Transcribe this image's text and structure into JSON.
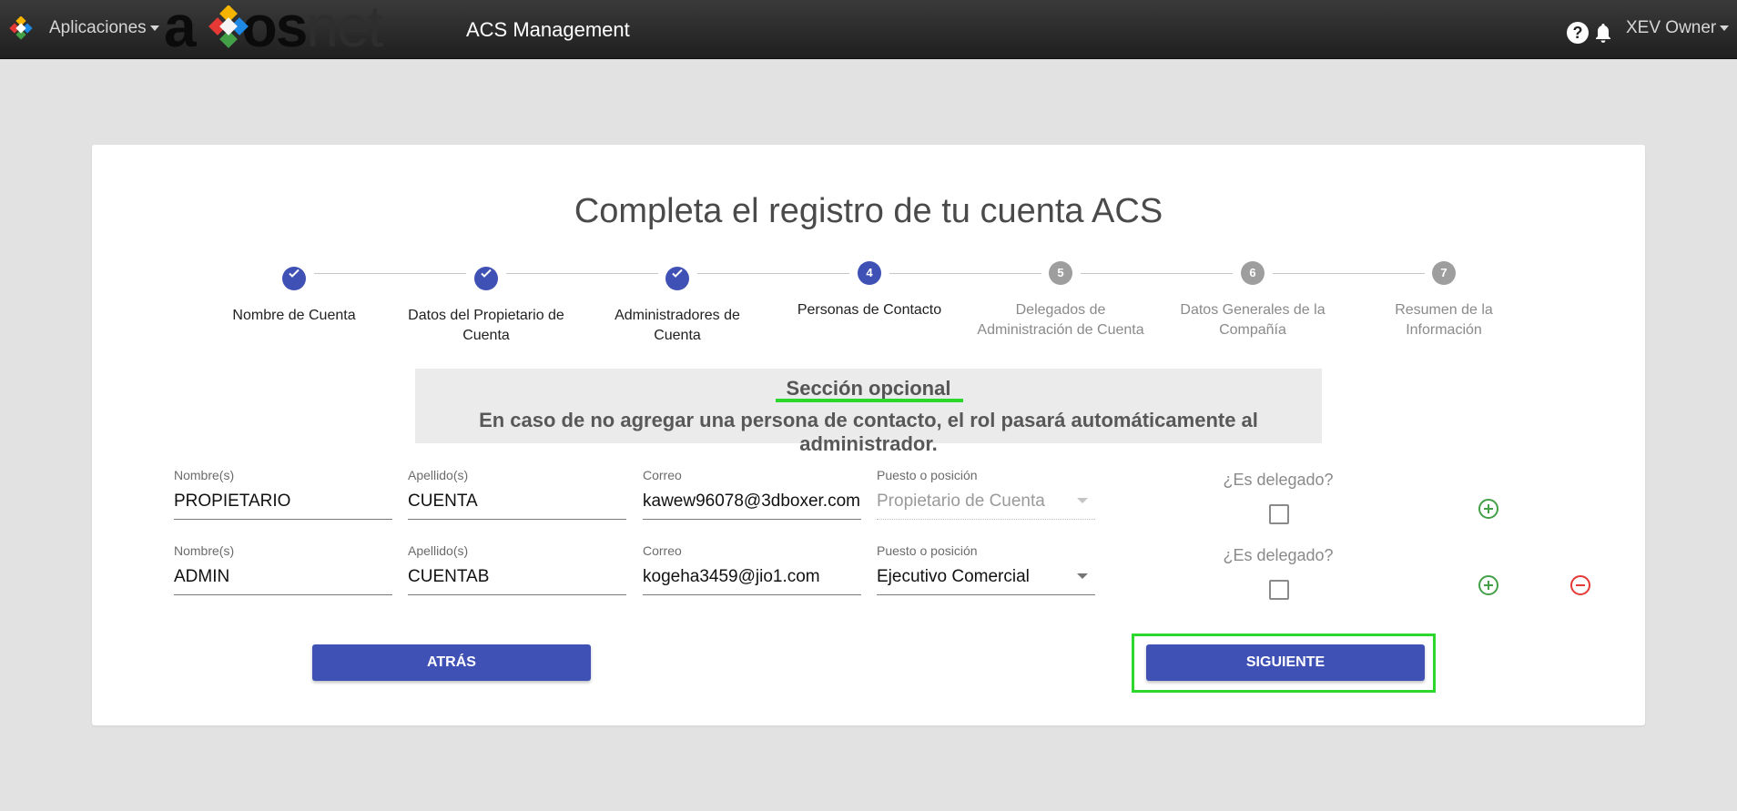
{
  "navbar": {
    "apps_label": "Aplicaciones",
    "brand_dark": "a",
    "brand_dark2": "os",
    "brand_light": "net",
    "app_title": "ACS Management",
    "help_symbol": "?",
    "user_label": "XEV Owner",
    "icons": [
      "app-grid-logo-icon",
      "help-icon",
      "bell-icon",
      "caret-down-icon"
    ]
  },
  "page": {
    "title": "Completa el registro de tu cuenta ACS"
  },
  "stepper": {
    "steps": [
      {
        "number": "1",
        "label": "Nombre de Cuenta",
        "state": "completed"
      },
      {
        "number": "2",
        "label": "Datos del Propietario de Cuenta",
        "state": "completed"
      },
      {
        "number": "3",
        "label": "Administradores de Cuenta",
        "state": "completed"
      },
      {
        "number": "4",
        "label": "Personas de Contacto",
        "state": "active"
      },
      {
        "number": "5",
        "label": "Delegados de Administración de Cuenta",
        "state": "pending"
      },
      {
        "number": "6",
        "label": "Datos Generales de la Compañía",
        "state": "pending"
      },
      {
        "number": "7",
        "label": "Resumen de la Información",
        "state": "pending"
      }
    ]
  },
  "notice": {
    "title": "Sección opcional",
    "text": "En caso de no agregar una persona de contacto, el rol pasará automáticamente al administrador."
  },
  "contacts": [
    {
      "first_name_label": "Nombre(s)",
      "first_name": "PROPIETARIO",
      "last_name_label": "Apellido(s)",
      "last_name": "CUENTA",
      "email_label": "Correo",
      "email": "kawew96078@3dboxer.com",
      "position_label": "Puesto o posición",
      "position": "Propietario de Cuenta",
      "position_disabled": true,
      "delegate_label": "¿Es delegado?",
      "delegate_checked": false
    },
    {
      "first_name_label": "Nombre(s)",
      "first_name": "ADMIN",
      "last_name_label": "Apellido(s)",
      "last_name": "CUENTAB",
      "email_label": "Correo",
      "email": "kogeha3459@jio1.com",
      "position_label": "Puesto o posición",
      "position": "Ejecutivo Comercial",
      "position_disabled": false,
      "delegate_label": "¿Es delegado?",
      "delegate_checked": false
    }
  ],
  "buttons": {
    "back": "ATRÁS",
    "next": "SIGUIENTE"
  },
  "colors": {
    "primary": "#3f51b5",
    "inactive_step": "#9e9e9e",
    "add": "#43a047",
    "remove": "#e53935",
    "highlight": "#2bd82b"
  }
}
